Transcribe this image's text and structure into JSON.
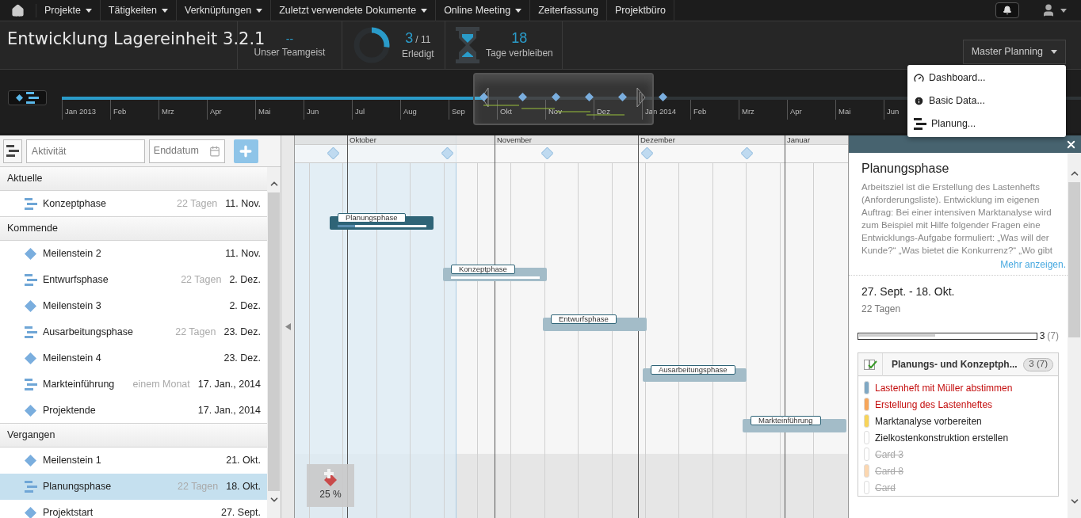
{
  "nav": {
    "items": [
      {
        "label": "Projekte",
        "dropdown": true
      },
      {
        "label": "Tätigkeiten",
        "dropdown": true
      },
      {
        "label": "Verknüpfungen",
        "dropdown": true
      },
      {
        "label": "Zuletzt verwendete Dokumente",
        "dropdown": true
      },
      {
        "label": "Online Meeting",
        "dropdown": true
      },
      {
        "label": "Zeiterfassung",
        "dropdown": false
      },
      {
        "label": "Projektbüro",
        "dropdown": false
      }
    ]
  },
  "project": {
    "title": "Entwicklung Lagereinheit 3.2.1"
  },
  "stats": {
    "team_spirit": {
      "value": "--",
      "label": "Unser Teamgeist"
    },
    "done": {
      "count": "3",
      "total": "/ 11",
      "label": "Erledigt",
      "level": 0.27
    },
    "remaining": {
      "value": "18",
      "label": "Tage verbleiben"
    }
  },
  "view_button": {
    "label": "Master Planning"
  },
  "view_menu": {
    "items": [
      {
        "kind": "dashboard",
        "label": "Dashboard..."
      },
      {
        "kind": "info",
        "label": "Basic Data..."
      },
      {
        "kind": "planning",
        "label": "Planung..."
      }
    ]
  },
  "timeline": {
    "months": [
      "Jan 2013",
      "Feb",
      "Mrz",
      "Apr",
      "Mai",
      "Jun",
      "Jul",
      "Aug",
      "Sep",
      "Okt",
      "Nov",
      "Dez",
      "Jan 2014",
      "Feb",
      "Mrz",
      "Apr",
      "Mai",
      "Jun"
    ]
  },
  "toolbar": {
    "activity_placeholder": "Aktivität",
    "date_placeholder": "Enddatum"
  },
  "groups": [
    {
      "title": "Aktuelle",
      "items": [
        {
          "kind": "phase",
          "name": "Konzeptphase",
          "duration": "22 Tagen",
          "date": "11. Nov.",
          "selected": false
        }
      ]
    },
    {
      "title": "Kommende",
      "items": [
        {
          "kind": "milestone",
          "name": "Meilenstein 2",
          "date": "11. Nov.",
          "selected": false
        },
        {
          "kind": "phase",
          "name": "Entwurfsphase",
          "duration": "22 Tagen",
          "date": "2. Dez.",
          "selected": false
        },
        {
          "kind": "milestone",
          "name": "Meilenstein 3",
          "date": "2. Dez.",
          "selected": false
        },
        {
          "kind": "phase",
          "name": "Ausarbeitungsphase",
          "duration": "22 Tagen",
          "date": "23. Dez.",
          "selected": false
        },
        {
          "kind": "milestone",
          "name": "Meilenstein 4",
          "date": "23. Dez.",
          "selected": false
        },
        {
          "kind": "phase",
          "name": "Markteinführung",
          "duration": "einem Monat",
          "date": "17. Jan., 2014",
          "selected": false
        },
        {
          "kind": "milestone",
          "name": "Projektende",
          "date": "17. Jan., 2014",
          "selected": false
        }
      ]
    },
    {
      "title": "Vergangen",
      "items": [
        {
          "kind": "milestone",
          "name": "Meilenstein 1",
          "date": "21. Okt.",
          "selected": false
        },
        {
          "kind": "phase",
          "name": "Planungsphase",
          "duration": "22 Tagen",
          "date": "18. Okt.",
          "selected": true
        },
        {
          "kind": "milestone",
          "name": "Projektstart",
          "date": "27. Sept.",
          "selected": false
        }
      ]
    }
  ],
  "gantt": {
    "months": [
      "Oktober",
      "November",
      "Dezember",
      "Januar"
    ],
    "bars": [
      {
        "label": "Planungsphase",
        "selected": true,
        "level": 0.2
      },
      {
        "label": "Konzeptphase",
        "selected": false,
        "level": 0
      },
      {
        "label": "Entwurfsphase",
        "selected": false
      },
      {
        "label": "Ausarbeitungsphase",
        "selected": false
      },
      {
        "label": "Markteinführung",
        "selected": false
      }
    ],
    "zoom": "25 %"
  },
  "detail": {
    "title": "Planungsphase",
    "description": "Arbeitsziel ist die Erstellung des Lastenhefts (Anforderungsliste). Entwicklung im eigenen Auftrag: Bei einer intensiven Marktanalyse wird zum Beispiel mit Hilfe folgender Fragen eine Entwicklungs-Aufgabe formuliert: „Was will der Kunde?“ „Was bietet die Konkurrenz?“ „Wo gibt",
    "more_link": "Mehr anzeigen.",
    "dates": "27. Sept. - 18. Okt.",
    "duration": "22 Tagen",
    "progress": {
      "level": 0.43,
      "count": "3",
      "total": "(7)"
    },
    "checklist": {
      "title": "Planungs- und Konzeptph...",
      "badge": "3 (7)",
      "cards": [
        {
          "label": "Lastenheft mit Müller abstimmen",
          "color": "#7fa8c4",
          "overdue": true,
          "done": false
        },
        {
          "label": "Erstellung des Lastenheftes",
          "color": "#f7a65a",
          "overdue": true,
          "done": false
        },
        {
          "label": "Marktanalyse vorbereiten",
          "color": "#f8d45a",
          "overdue": false,
          "done": false
        },
        {
          "label": "Zielkostenkonstruktion erstellen",
          "color": "#ffffff",
          "overdue": false,
          "done": false
        },
        {
          "label": "Card 3",
          "color": "#ffffff",
          "overdue": false,
          "done": true
        },
        {
          "label": "Card 8",
          "color": "#fcd7b0",
          "overdue": false,
          "done": true
        },
        {
          "label": "Card",
          "color": "#ffffff",
          "overdue": false,
          "done": true
        }
      ]
    }
  }
}
